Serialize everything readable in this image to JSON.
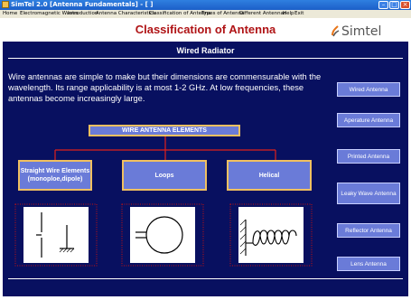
{
  "window": {
    "title": "SimTel 2.0 [Antenna Fundamentals] - [ ]"
  },
  "menu": [
    "Home",
    "Electromagnetic Waves",
    "Introduction",
    "Antenna Characteristics",
    "Classification of Antenna",
    "Types of Antenna",
    "Different Antennas",
    "Help",
    "Exit"
  ],
  "header": {
    "title": "Classification of Antenna",
    "logo": "Simtel"
  },
  "section": {
    "title": "Wired Radiator",
    "paragraph": "Wire antennas are simple to make but their dimensions are commensurable with the wavelength. Its range applicability is at most 1-2 GHz. At low frequencies, these antennas become increasingly large."
  },
  "diagram": {
    "root": "WIRE ANTENNA ELEMENTS",
    "categories": [
      "Straight Wire Elements (monoploe,dipole)",
      "Loops",
      "Helical"
    ]
  },
  "sidebar": [
    "Wired Antenna",
    "Aperature Antenna",
    "Printed Antenna",
    "Leaky Wave Antenna",
    "Reflector Antenna",
    "Lens Antenna"
  ],
  "colors": {
    "panel": "#081060",
    "button": "#6a7bd8",
    "heading": "#b01416",
    "connector": "#e0201a",
    "border": "#f0c060"
  },
  "icons": [
    "app-icon",
    "minimize-icon",
    "maximize-icon",
    "close-icon",
    "simtel-logo-icon",
    "monopole-dipole-icon",
    "loop-icon",
    "helical-icon"
  ]
}
